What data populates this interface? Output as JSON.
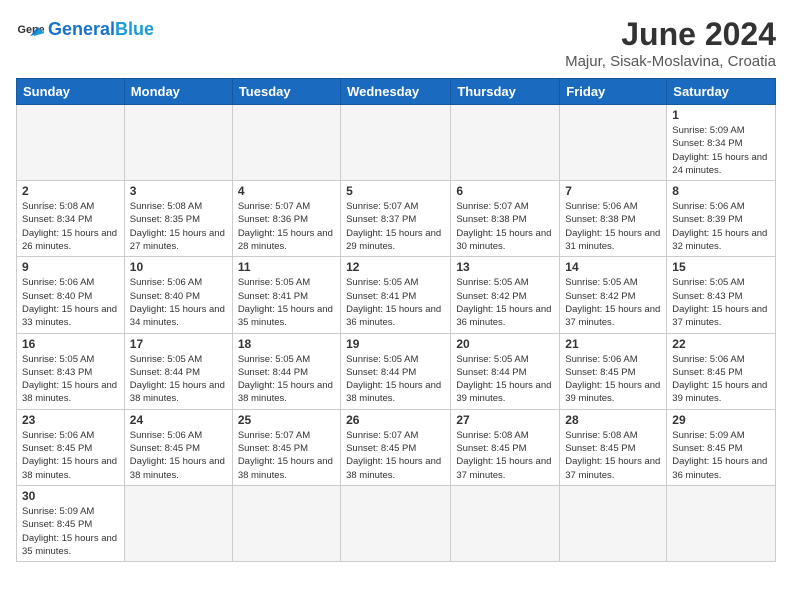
{
  "header": {
    "logo_general": "General",
    "logo_blue": "Blue",
    "month_title": "June 2024",
    "location": "Majur, Sisak-Moslavina, Croatia"
  },
  "weekdays": [
    "Sunday",
    "Monday",
    "Tuesday",
    "Wednesday",
    "Thursday",
    "Friday",
    "Saturday"
  ],
  "weeks": [
    [
      {
        "day": "",
        "info": ""
      },
      {
        "day": "",
        "info": ""
      },
      {
        "day": "",
        "info": ""
      },
      {
        "day": "",
        "info": ""
      },
      {
        "day": "",
        "info": ""
      },
      {
        "day": "",
        "info": ""
      },
      {
        "day": "1",
        "info": "Sunrise: 5:09 AM\nSunset: 8:34 PM\nDaylight: 15 hours\nand 24 minutes."
      }
    ],
    [
      {
        "day": "2",
        "info": "Sunrise: 5:08 AM\nSunset: 8:34 PM\nDaylight: 15 hours\nand 26 minutes."
      },
      {
        "day": "3",
        "info": "Sunrise: 5:08 AM\nSunset: 8:35 PM\nDaylight: 15 hours\nand 27 minutes."
      },
      {
        "day": "4",
        "info": "Sunrise: 5:07 AM\nSunset: 8:36 PM\nDaylight: 15 hours\nand 28 minutes."
      },
      {
        "day": "5",
        "info": "Sunrise: 5:07 AM\nSunset: 8:37 PM\nDaylight: 15 hours\nand 29 minutes."
      },
      {
        "day": "6",
        "info": "Sunrise: 5:07 AM\nSunset: 8:38 PM\nDaylight: 15 hours\nand 30 minutes."
      },
      {
        "day": "7",
        "info": "Sunrise: 5:06 AM\nSunset: 8:38 PM\nDaylight: 15 hours\nand 31 minutes."
      },
      {
        "day": "8",
        "info": "Sunrise: 5:06 AM\nSunset: 8:39 PM\nDaylight: 15 hours\nand 32 minutes."
      }
    ],
    [
      {
        "day": "9",
        "info": "Sunrise: 5:06 AM\nSunset: 8:40 PM\nDaylight: 15 hours\nand 33 minutes."
      },
      {
        "day": "10",
        "info": "Sunrise: 5:06 AM\nSunset: 8:40 PM\nDaylight: 15 hours\nand 34 minutes."
      },
      {
        "day": "11",
        "info": "Sunrise: 5:05 AM\nSunset: 8:41 PM\nDaylight: 15 hours\nand 35 minutes."
      },
      {
        "day": "12",
        "info": "Sunrise: 5:05 AM\nSunset: 8:41 PM\nDaylight: 15 hours\nand 36 minutes."
      },
      {
        "day": "13",
        "info": "Sunrise: 5:05 AM\nSunset: 8:42 PM\nDaylight: 15 hours\nand 36 minutes."
      },
      {
        "day": "14",
        "info": "Sunrise: 5:05 AM\nSunset: 8:42 PM\nDaylight: 15 hours\nand 37 minutes."
      },
      {
        "day": "15",
        "info": "Sunrise: 5:05 AM\nSunset: 8:43 PM\nDaylight: 15 hours\nand 37 minutes."
      }
    ],
    [
      {
        "day": "16",
        "info": "Sunrise: 5:05 AM\nSunset: 8:43 PM\nDaylight: 15 hours\nand 38 minutes."
      },
      {
        "day": "17",
        "info": "Sunrise: 5:05 AM\nSunset: 8:44 PM\nDaylight: 15 hours\nand 38 minutes."
      },
      {
        "day": "18",
        "info": "Sunrise: 5:05 AM\nSunset: 8:44 PM\nDaylight: 15 hours\nand 38 minutes."
      },
      {
        "day": "19",
        "info": "Sunrise: 5:05 AM\nSunset: 8:44 PM\nDaylight: 15 hours\nand 38 minutes."
      },
      {
        "day": "20",
        "info": "Sunrise: 5:05 AM\nSunset: 8:44 PM\nDaylight: 15 hours\nand 39 minutes."
      },
      {
        "day": "21",
        "info": "Sunrise: 5:06 AM\nSunset: 8:45 PM\nDaylight: 15 hours\nand 39 minutes."
      },
      {
        "day": "22",
        "info": "Sunrise: 5:06 AM\nSunset: 8:45 PM\nDaylight: 15 hours\nand 39 minutes."
      }
    ],
    [
      {
        "day": "23",
        "info": "Sunrise: 5:06 AM\nSunset: 8:45 PM\nDaylight: 15 hours\nand 38 minutes."
      },
      {
        "day": "24",
        "info": "Sunrise: 5:06 AM\nSunset: 8:45 PM\nDaylight: 15 hours\nand 38 minutes."
      },
      {
        "day": "25",
        "info": "Sunrise: 5:07 AM\nSunset: 8:45 PM\nDaylight: 15 hours\nand 38 minutes."
      },
      {
        "day": "26",
        "info": "Sunrise: 5:07 AM\nSunset: 8:45 PM\nDaylight: 15 hours\nand 38 minutes."
      },
      {
        "day": "27",
        "info": "Sunrise: 5:08 AM\nSunset: 8:45 PM\nDaylight: 15 hours\nand 37 minutes."
      },
      {
        "day": "28",
        "info": "Sunrise: 5:08 AM\nSunset: 8:45 PM\nDaylight: 15 hours\nand 37 minutes."
      },
      {
        "day": "29",
        "info": "Sunrise: 5:09 AM\nSunset: 8:45 PM\nDaylight: 15 hours\nand 36 minutes."
      }
    ],
    [
      {
        "day": "30",
        "info": "Sunrise: 5:09 AM\nSunset: 8:45 PM\nDaylight: 15 hours\nand 35 minutes."
      },
      {
        "day": "",
        "info": ""
      },
      {
        "day": "",
        "info": ""
      },
      {
        "day": "",
        "info": ""
      },
      {
        "day": "",
        "info": ""
      },
      {
        "day": "",
        "info": ""
      },
      {
        "day": "",
        "info": ""
      }
    ]
  ]
}
